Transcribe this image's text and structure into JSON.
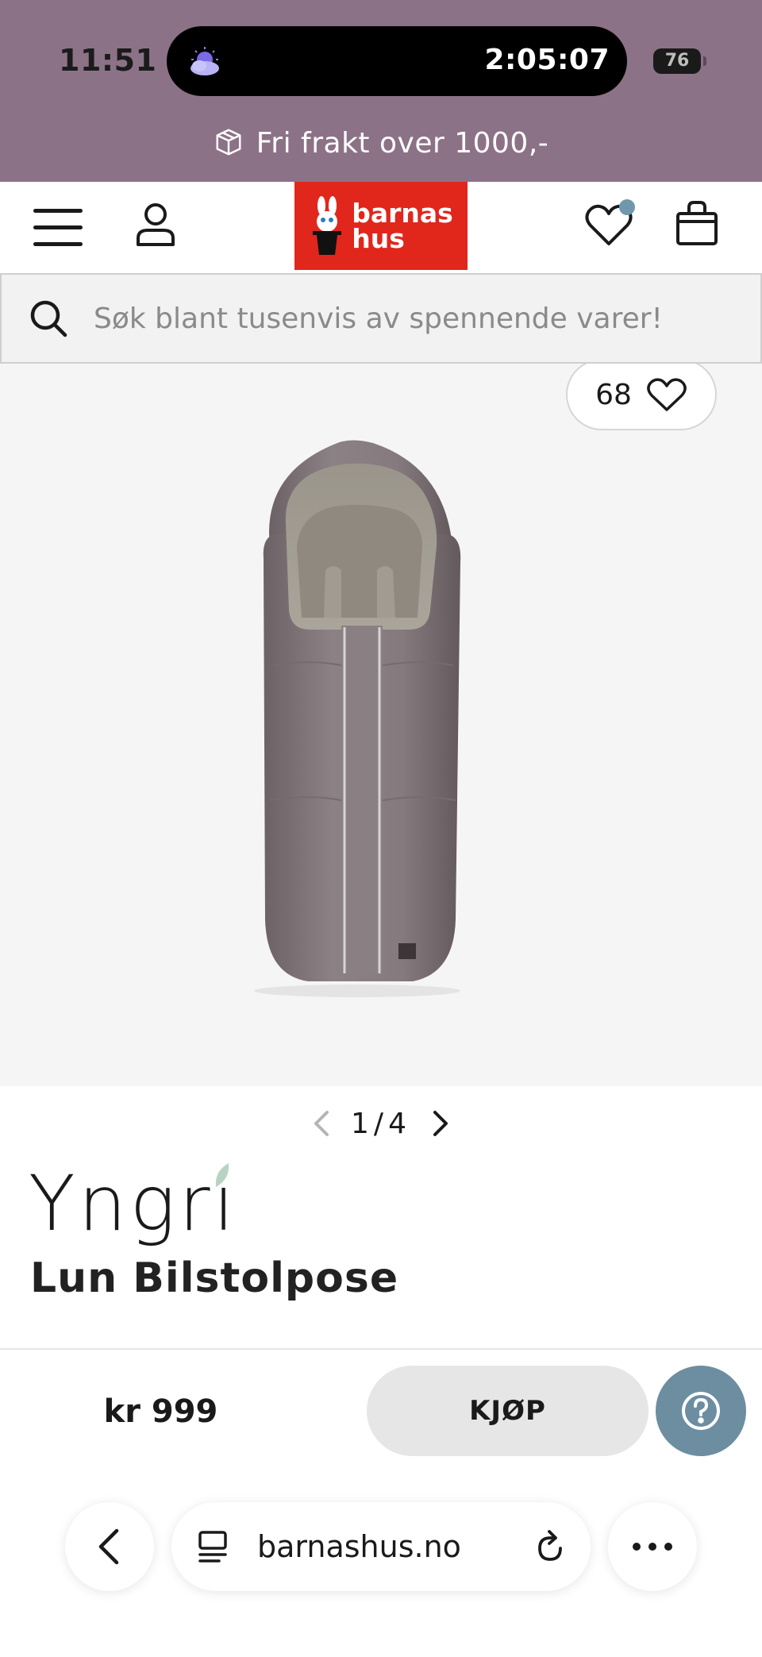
{
  "status_bar": {
    "time": "11:51",
    "island_timer": "2:05:07",
    "battery": "76"
  },
  "promo": {
    "text": "Fri frakt over 1000,-",
    "icon": "package-icon"
  },
  "header": {
    "logo_text_line1": "barnas",
    "logo_text_line2": "hus",
    "brand_color": "#e1261c",
    "icons": [
      "menu-icon",
      "user-icon",
      "heart-icon",
      "shopping-bag-icon"
    ],
    "wishlist_dot_color": "#6f98ad"
  },
  "search": {
    "placeholder": "Søk blant tusenvis av spennende varer!"
  },
  "product": {
    "like_count": "68",
    "pager_current": "1",
    "pager_separator": "/",
    "pager_total": "4",
    "brand": "Yngri",
    "title": "Lun Bilstolpose",
    "price": "kr 999",
    "buy_label": "KJØP"
  },
  "browser": {
    "url": "barnashus.no",
    "icons": [
      "back-chevron-icon",
      "tabs-icon",
      "reload-icon",
      "more-icon"
    ]
  },
  "colors": {
    "top_band": "#8c7287",
    "help_button": "#6c8ea0",
    "buy_button": "#e6e6e6"
  }
}
